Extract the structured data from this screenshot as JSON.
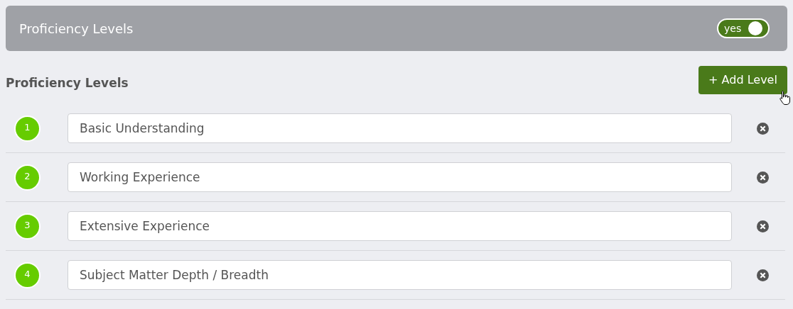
{
  "header": {
    "title": "Proficiency Levels",
    "toggle": {
      "label": "yes",
      "on": true
    }
  },
  "section": {
    "heading": "Proficiency Levels",
    "add_button": "+ Add Level"
  },
  "levels": [
    {
      "number": "1",
      "value": "Basic Understanding"
    },
    {
      "number": "2",
      "value": "Working Experience"
    },
    {
      "number": "3",
      "value": "Extensive Experience"
    },
    {
      "number": "4",
      "value": "Subject Matter Depth / Breadth"
    }
  ]
}
